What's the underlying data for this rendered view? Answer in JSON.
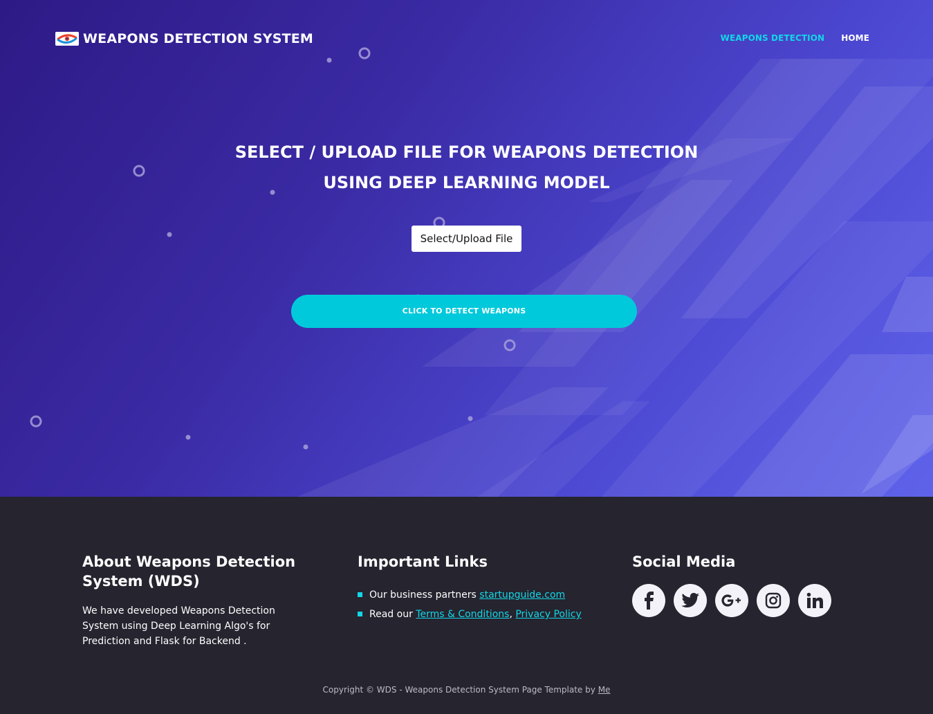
{
  "header": {
    "brand_title": "WEAPONS DETECTION SYSTEM",
    "nav": [
      {
        "label": "WEAPONS DETECTION",
        "active": true
      },
      {
        "label": "HOME",
        "active": false
      }
    ]
  },
  "hero": {
    "title_line1": "SELECT / UPLOAD FILE FOR WEAPONS DETECTION",
    "title_line2": "USING DEEP LEARNING MODEL",
    "upload_button_label": "Select/Upload File",
    "detect_button_label": "CLICK TO DETECT WEAPONS"
  },
  "footer": {
    "about": {
      "heading": "About Weapons Detection System (WDS)",
      "text": "We have developed Weapons Detection System using Deep Learning Algo's for Prediction and Flask for Backend ."
    },
    "links": {
      "heading": "Important Links",
      "item1_prefix": "Our business partners",
      "item1_link": "startupguide.com",
      "item2_prefix": "Read our",
      "item2_link1": "Terms & Conditions",
      "item2_sep": ",",
      "item2_link2": "Privacy Policy"
    },
    "social": {
      "heading": "Social Media",
      "icons": [
        "facebook-icon",
        "twitter-icon",
        "google-plus-icon",
        "instagram-icon",
        "linkedin-icon"
      ]
    },
    "copyright_text": "Copyright © WDS - Weapons Detection System Page Template by",
    "copyright_link": "Me"
  },
  "colors": {
    "accent": "#14d6e6",
    "detect_button": "#00c9db",
    "footer_bg": "#25242f"
  }
}
